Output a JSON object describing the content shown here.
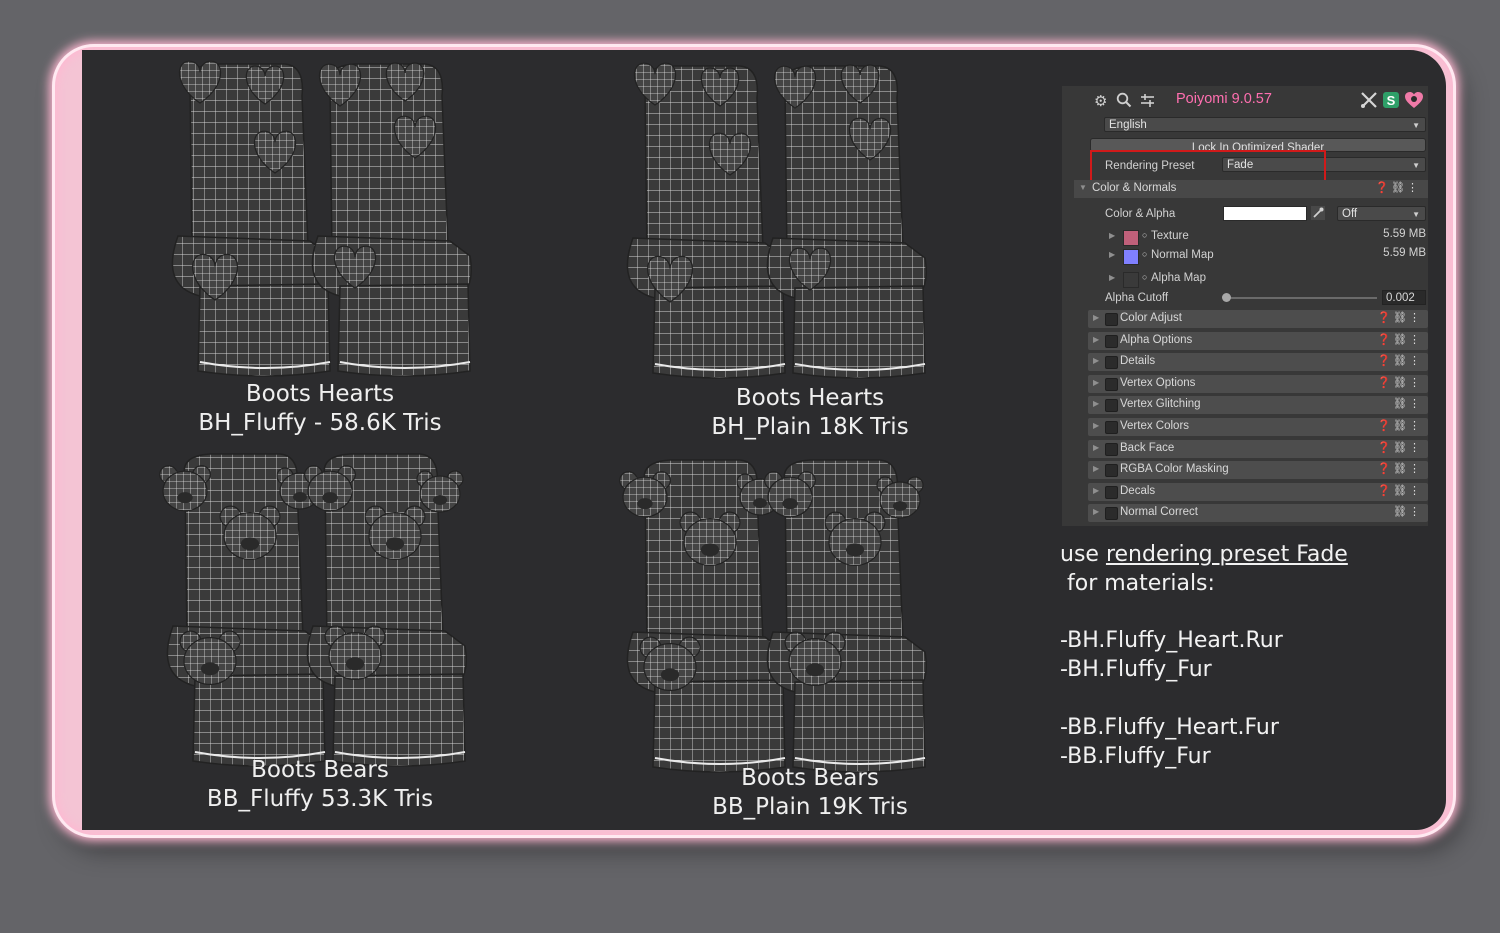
{
  "models": [
    {
      "name": "Boots Hearts",
      "detail": "BH_Fluffy - 58.6K Tris",
      "variant": "hearts"
    },
    {
      "name": "Boots Hearts",
      "detail": "BH_Plain  18K Tris",
      "variant": "hearts"
    },
    {
      "name": "Boots Bears",
      "detail": "BB_Fluffy  53.3K Tris",
      "variant": "bears"
    },
    {
      "name": "Boots Bears",
      "detail": "BB_Plain  19K Tris",
      "variant": "bears"
    }
  ],
  "inspector": {
    "title": "Poiyomi 9.0.57",
    "title_color": "#ff6fb0",
    "toolbar_icons": [
      "gear-icon",
      "search-icon",
      "sliders-icon"
    ],
    "toolbar_right_icons": [
      "tools-icon",
      "shader-icon",
      "heart-icon"
    ],
    "language": "English",
    "lock_button": "Lock In Optimized Shader",
    "rendering_preset": {
      "label": "Rendering Preset",
      "value": "Fade"
    },
    "section": "Color & Normals",
    "color_alpha": {
      "label": "Color & Alpha",
      "swatch_color": "#ffffff",
      "mode": "Off"
    },
    "textures": [
      {
        "label": "Texture",
        "size": "5.59 MB",
        "swatch": "#c0607a"
      },
      {
        "label": "Normal Map",
        "size": "5.59 MB",
        "swatch": "#8080ff"
      },
      {
        "label": "Alpha Map",
        "size": "",
        "swatch": ""
      }
    ],
    "alpha_cutoff": {
      "label": "Alpha Cutoff",
      "value": "0.002",
      "fraction": 0.002
    },
    "modules": [
      {
        "label": "Color Adjust",
        "help": true
      },
      {
        "label": "Alpha Options",
        "help": true
      },
      {
        "label": "Details",
        "help": true
      },
      {
        "label": "Vertex Options",
        "help": true
      },
      {
        "label": "Vertex Glitching",
        "help": false
      },
      {
        "label": "Vertex Colors",
        "help": true
      },
      {
        "label": "Back Face",
        "help": true
      },
      {
        "label": "RGBA Color Masking",
        "help": true
      },
      {
        "label": "Decals",
        "help": true
      },
      {
        "label": "Normal Correct",
        "help": false
      }
    ]
  },
  "instructions": {
    "line1_prefix": "use ",
    "line1_link": "rendering preset Fade",
    "line2": " for materials:",
    "items_a": [
      "-BH.Fluffy_Heart.Rur",
      "-BH.Fluffy_Fur"
    ],
    "items_b": [
      "-BB.Fluffy_Heart.Fur",
      "-BB.Fluffy_Fur"
    ]
  }
}
